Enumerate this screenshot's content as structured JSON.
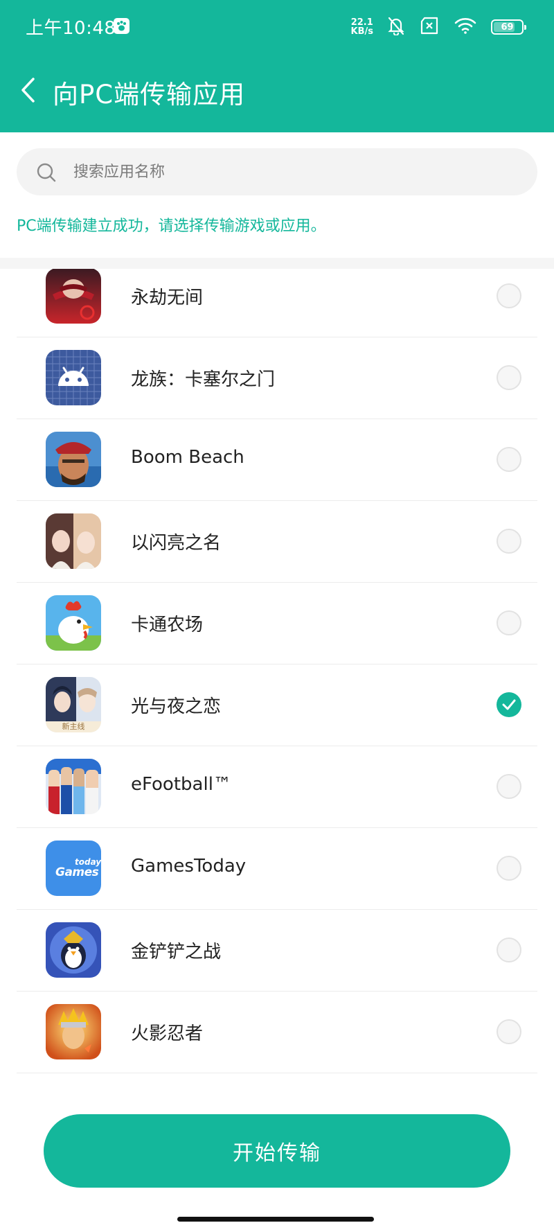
{
  "status_bar": {
    "time": "上午10:48",
    "net_speed_value": "22.1",
    "net_speed_unit": "KB/s",
    "battery_level": "69",
    "battery_fraction": 0.69,
    "icons": [
      "baidu-app-icon",
      "bell-muted-icon",
      "sim-off-icon",
      "wifi-icon",
      "battery-icon"
    ]
  },
  "header": {
    "title": "向PC端传输应用",
    "back_icon": "chevron-left-icon"
  },
  "search": {
    "placeholder": "搜索应用名称",
    "value": ""
  },
  "hint": "PC端传输建立成功，请选择传输游戏或应用。",
  "apps": [
    {
      "name": "永劫无间",
      "selected": false,
      "icon": "naraka-app-icon",
      "icon_color": "#c8252b"
    },
    {
      "name": "龙族：卡塞尔之门",
      "selected": false,
      "icon": "android-app-icon",
      "icon_color": "#3d5a9e"
    },
    {
      "name": "Boom Beach",
      "selected": false,
      "icon": "boom-beach-app-icon",
      "icon_color": "#7a4a2a"
    },
    {
      "name": "以闪亮之名",
      "selected": false,
      "icon": "shining-app-icon",
      "icon_color": "#e8d2c8"
    },
    {
      "name": "卡通农场",
      "selected": false,
      "icon": "hay-day-app-icon",
      "icon_color": "#4fb0e8"
    },
    {
      "name": "光与夜之恋",
      "selected": true,
      "icon": "light-and-night-app-icon",
      "icon_color": "#2e3a5a",
      "icon_badge": "新主线"
    },
    {
      "name": "eFootball™",
      "selected": false,
      "icon": "efootball-app-icon",
      "icon_color": "#1d4fa8"
    },
    {
      "name": "GamesToday",
      "selected": false,
      "icon": "gamestoday-app-icon",
      "icon_color": "#3e8fe8",
      "icon_label": "today",
      "icon_wordmark": "Games"
    },
    {
      "name": "金铲铲之战",
      "selected": false,
      "icon": "golden-spatula-app-icon",
      "icon_color": "#3553b8"
    },
    {
      "name": "火影忍者",
      "selected": false,
      "icon": "naruto-app-icon",
      "icon_color": "#e88a1e"
    }
  ],
  "start_button": {
    "label": "开始传输"
  },
  "colors": {
    "accent": "#14b79b",
    "background": "#ffffff",
    "search_bg": "#f3f3f3",
    "divider": "#ececec"
  }
}
